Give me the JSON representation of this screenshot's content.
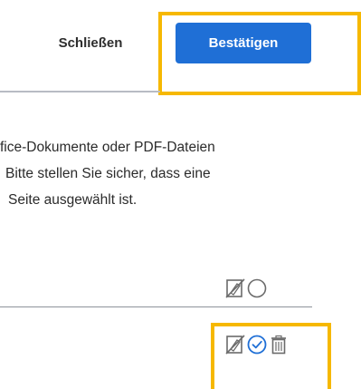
{
  "dialog": {
    "close_label": "Schließen",
    "confirm_label": "Bestätigen"
  },
  "message": {
    "line1": "fice-Dokumente oder PDF-Dateien",
    "line2": "Bitte stellen Sie sicher, dass eine",
    "line3": "Seite ausgewählt ist."
  },
  "rows": [
    {
      "icons": [
        "no-edit-icon",
        "radio-unselected-icon"
      ]
    },
    {
      "icons": [
        "no-edit-icon",
        "check-circle-icon",
        "trash-icon"
      ]
    }
  ],
  "colors": {
    "accent": "#1f6fd6",
    "highlight": "#f6b800",
    "check": "#1f6fd6"
  }
}
